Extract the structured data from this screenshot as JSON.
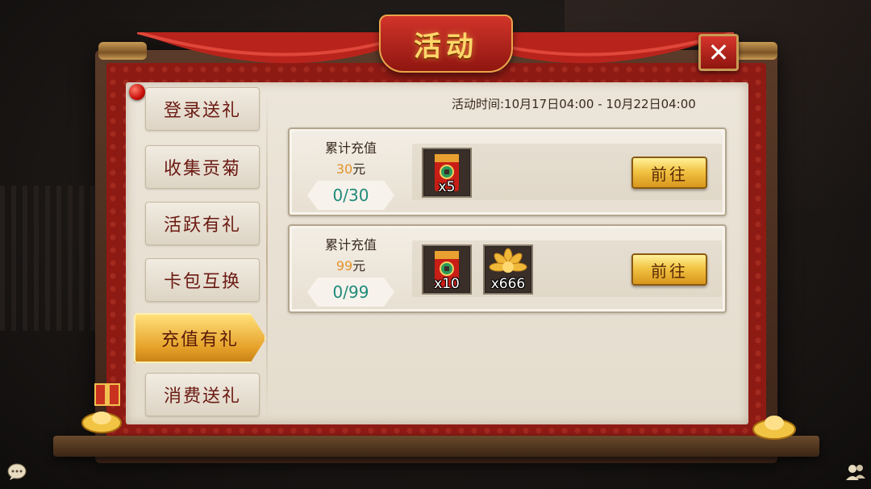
{
  "window": {
    "title": "活动",
    "close_label": "✕"
  },
  "event_time": "活动时间:10月17日04:00 - 10月22日04:00",
  "sidebar": {
    "tabs": [
      {
        "label": "登录送礼",
        "active": false
      },
      {
        "label": "收集贡菊",
        "active": false
      },
      {
        "label": "活跃有礼",
        "active": false
      },
      {
        "label": "卡包互换",
        "active": false
      },
      {
        "label": "充值有礼",
        "active": true
      },
      {
        "label": "消费送礼",
        "active": false
      }
    ]
  },
  "rewards": [
    {
      "label": "累计充值",
      "amount": "30",
      "unit": "元",
      "progress": "0/30",
      "button": "前往",
      "items": [
        {
          "icon": "red-envelope-icon",
          "qty": "x5"
        }
      ]
    },
    {
      "label": "累计充值",
      "amount": "99",
      "unit": "元",
      "progress": "0/99",
      "button": "前往",
      "items": [
        {
          "icon": "red-envelope-icon",
          "qty": "x10"
        },
        {
          "icon": "gold-chrysanthemum-icon",
          "qty": "x666"
        }
      ]
    }
  ],
  "colors": {
    "accent_gold": "#f2c444",
    "frame_red": "#8e1a14",
    "progress_teal": "#1f8a7a",
    "amount_orange": "#e3932b"
  }
}
